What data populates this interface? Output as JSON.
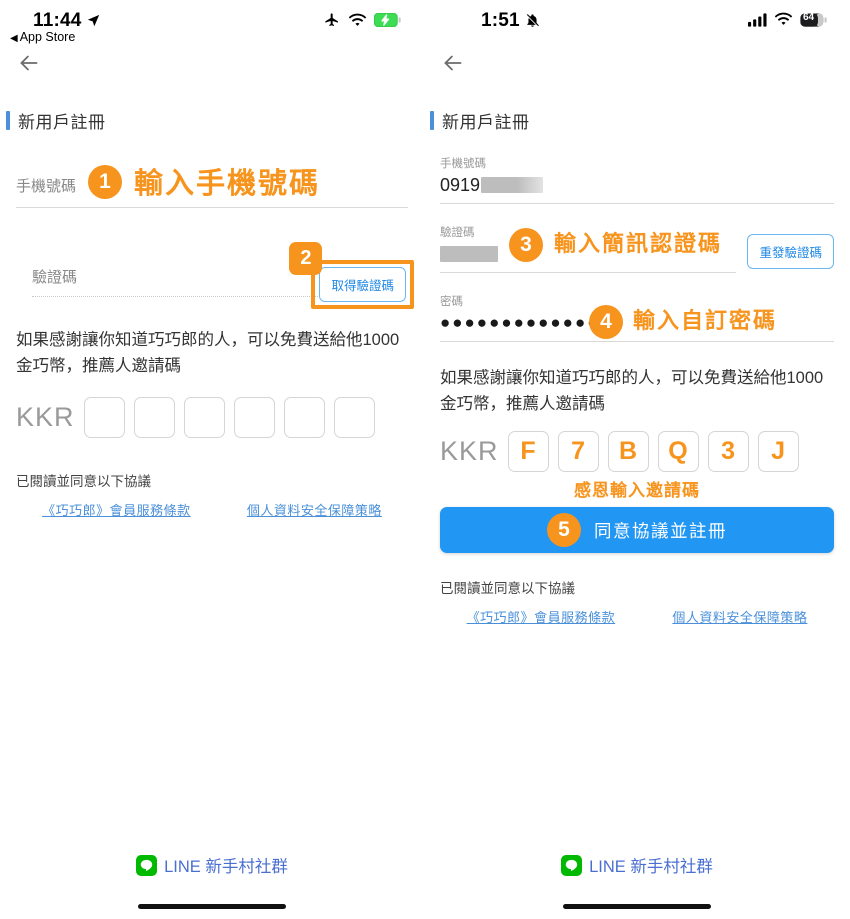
{
  "left": {
    "status": {
      "time": "11:44",
      "return_label": "App Store",
      "location_icon": "location-arrow-icon",
      "airplane_icon": "airplane-mode-icon",
      "wifi_icon": "wifi-icon",
      "battery_icon": "battery-charging-icon"
    },
    "nav": {
      "back_icon": "back-arrow-icon"
    },
    "section_title": "新用戶註冊",
    "phone": {
      "label": "手機號碼",
      "value": "",
      "annotation_number": "1",
      "annotation_text": "輸入手機號碼"
    },
    "verify": {
      "label": "驗證碼",
      "value": "",
      "button_label": "取得驗證碼",
      "annotation_number": "2"
    },
    "promo_text": "如果感謝讓你知道巧巧郎的人，可以免費送給他1000金巧幣，推薦人邀請碼",
    "invite": {
      "prefix": "KKR",
      "digits": [
        "",
        "",
        "",
        "",
        "",
        ""
      ]
    },
    "agreement": {
      "title": "已閱讀並同意以下協議",
      "links": [
        "《巧巧郎》會員服務條款",
        "個人資料安全保障策略"
      ]
    },
    "footer": {
      "icon": "line-icon",
      "text": "LINE 新手村社群"
    }
  },
  "right": {
    "status": {
      "time": "1:51",
      "mute_icon": "bell-slash-icon",
      "cellular_icon": "cellular-bars-icon",
      "wifi_icon": "wifi-icon",
      "battery_icon": "battery-icon",
      "battery_level": "64"
    },
    "nav": {
      "back_icon": "back-arrow-icon"
    },
    "section_title": "新用戶註冊",
    "phone": {
      "label": "手機號碼",
      "value": "0919",
      "redacted": true
    },
    "verify": {
      "label": "驗證碼",
      "value": "",
      "redacted": true,
      "button_label": "重發驗證碼",
      "annotation_number": "3",
      "annotation_text": "輸入簡訊認證碼"
    },
    "password": {
      "label": "密碼",
      "value": "●●●●●●●●●●●●●●●",
      "annotation_number": "4",
      "annotation_text": "輸入自訂密碼"
    },
    "promo_text": "如果感謝讓你知道巧巧郎的人，可以免費送給他1000金巧幣，推薦人邀請碼",
    "invite": {
      "prefix": "KKR",
      "digits": [
        "F",
        "7",
        "B",
        "Q",
        "3",
        "J"
      ],
      "annotation_text": "感恩輸入邀請碼"
    },
    "submit": {
      "number": "5",
      "label": "同意協議並註冊"
    },
    "agreement": {
      "title": "已閱讀並同意以下協議",
      "links": [
        "《巧巧郎》會員服務條款",
        "個人資料安全保障策略"
      ]
    },
    "footer": {
      "icon": "line-icon",
      "text": "LINE 新手村社群"
    }
  },
  "colors": {
    "accent_orange": "#f7941d",
    "accent_blue": "#2196f3",
    "link_blue": "#4a90d9",
    "line_green": "#00b900"
  }
}
